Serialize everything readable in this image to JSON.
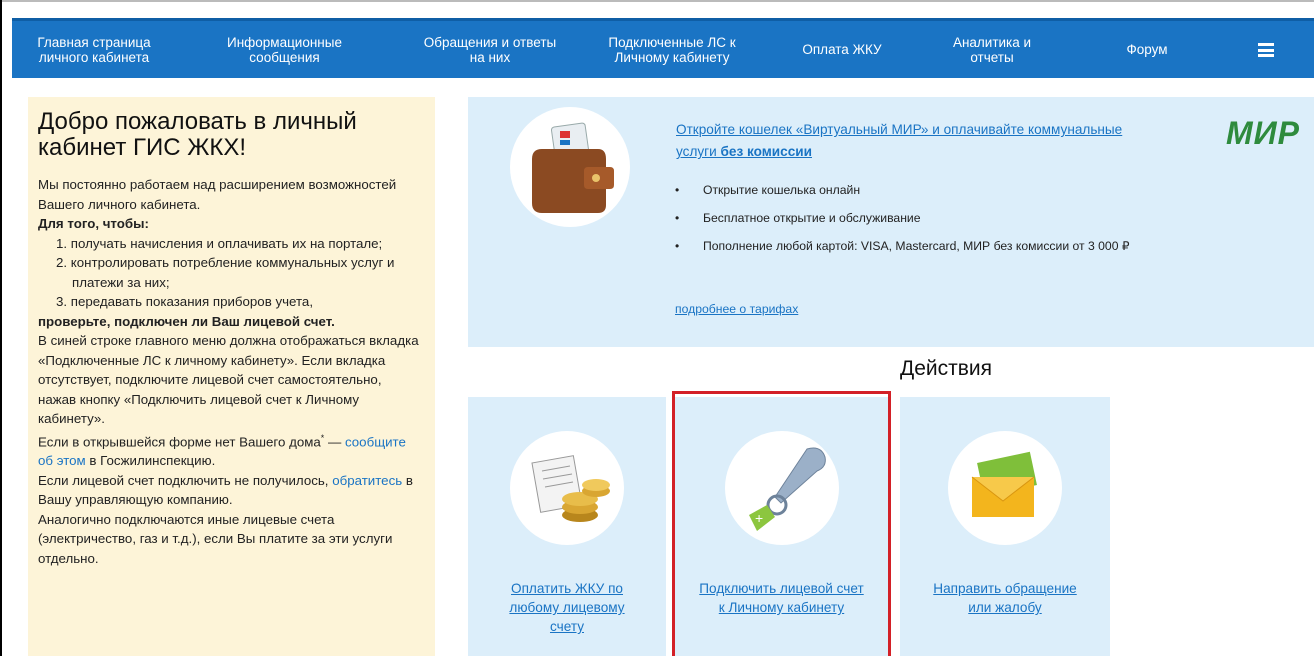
{
  "nav": {
    "items": [
      {
        "line1": "Главная страница",
        "line2": "личного кабинета"
      },
      {
        "line1": "Информационные",
        "line2": "сообщения"
      },
      {
        "line1": "Обращения и ответы",
        "line2": "на них"
      },
      {
        "line1": "Подключенные ЛС к",
        "line2": "Личному кабинету"
      },
      {
        "line1": "Оплата ЖКУ",
        "line2": ""
      },
      {
        "line1": "Аналитика и",
        "line2": "отчеты"
      },
      {
        "line1": "Форум",
        "line2": ""
      }
    ],
    "menu_icon": "hamburger-icon"
  },
  "welcome": {
    "title": "Добро пожаловать в личный кабинет ГИС ЖКХ!",
    "intro": "Мы постоянно работаем над расширением возможностей Вашего личного кабинета.",
    "for_that": "Для того, чтобы:",
    "list": [
      "1. получать начисления и оплачивать их на портале;",
      "2. контролировать потребление коммунальных услуг и платежи за них;",
      "3. передавать показания приборов учета,"
    ],
    "check": "проверьте, подключен ли Ваш лицевой счет.",
    "para1": "В синей строке главного меню должна отображаться вкладка «Подключенные ЛС к личному кабинету». Если вкладка отсутствует, подключите лицевой счет самостоятельно, нажав кнопку «Подключить лицевой счет к Личному кабинету».",
    "para2_pre": "Если в открывшейся форме нет Вашего дома",
    "para2_sup": "*",
    "para2_mid": " — ",
    "para2_link": "сообщите об этом",
    "para2_post": " в Госжилинспекцию.",
    "para3_pre": "Если лицевой счет подключить не получилось, ",
    "para3_link": "обратитесь",
    "para3_post": " в Вашу управляющую компанию.",
    "para4": "Аналогично подключаются иные лицевые счета (электричество, газ и т.д.), если Вы платите за эти услуги отдельно."
  },
  "promo": {
    "title_pre": "Откройте кошелек «Виртуальный МИР» и оплачивайте коммунальные услуги ",
    "title_bold": "без комиссии",
    "bullets": [
      "Открытие кошелька онлайн",
      "Бесплатное открытие и обслуживание",
      "Пополнение любой картой: VISA, Mastercard, МИР без комиссии от 3 000 ₽"
    ],
    "more": "подробнее о тарифах",
    "logo": "МИР"
  },
  "actions": {
    "title": "Действия",
    "cards": [
      {
        "label": "Оплатить ЖКУ по любому лицевому счету",
        "icon": "receipt-coins-icon"
      },
      {
        "label": "Подключить лицевой счет к Личному кабинету",
        "icon": "key-icon"
      },
      {
        "label": "Направить обращение или жалобу",
        "icon": "envelope-icon"
      }
    ]
  },
  "colors": {
    "nav_bg": "#1a74c4",
    "panel_bg": "#fdf4d8",
    "card_bg": "#dceefa",
    "link": "#1a74c4",
    "highlight": "#d32027",
    "mir_green": "#2e8b3d"
  }
}
